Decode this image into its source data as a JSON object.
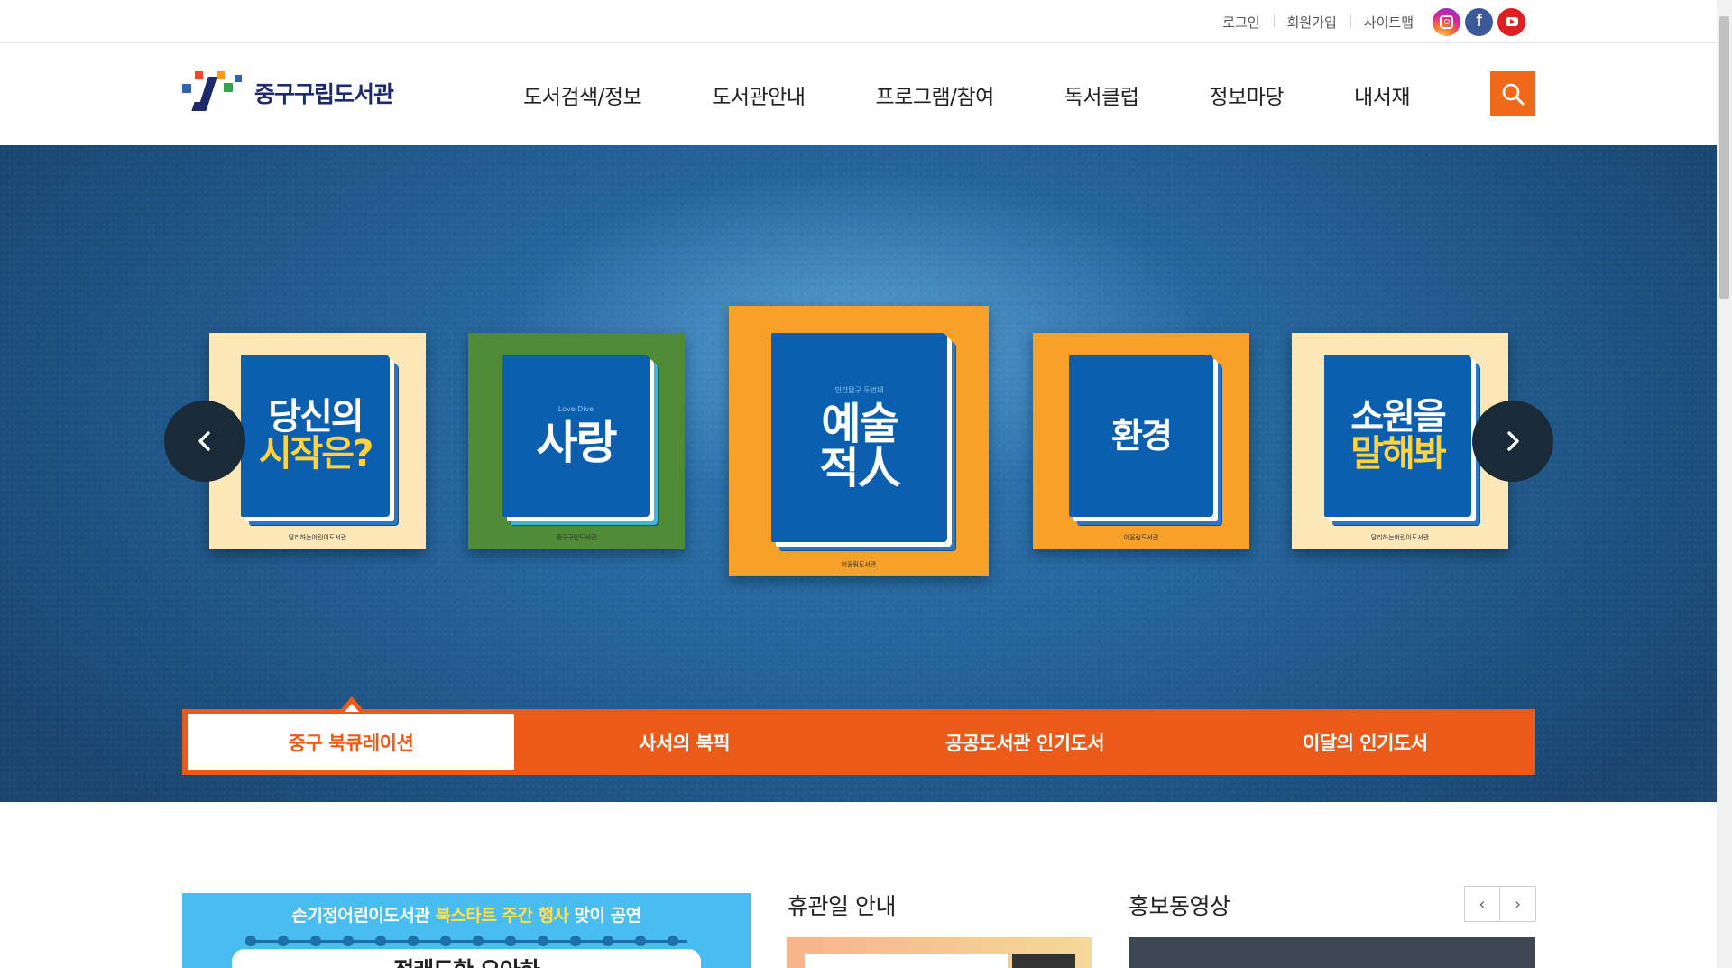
{
  "top_links": {
    "login": "로그인",
    "join": "회원가입",
    "sitemap": "사이트맵"
  },
  "sns": [
    "instagram-icon",
    "facebook-icon",
    "youtube-icon"
  ],
  "logo": {
    "text": "중구구립도서관"
  },
  "gnb": [
    "도서검색/정보",
    "도서관안내",
    "프로그램/참여",
    "독서클럽",
    "정보마당",
    "내서재"
  ],
  "slides": [
    {
      "title_line1": "당신의",
      "title_line2": "시작은?",
      "footer": "달리하는어린이도서관",
      "background": "#fbe7b8"
    },
    {
      "subtitle": "Love Dive",
      "title_line1": "사랑",
      "footer": "중구구립도서관",
      "background": "#4f8a34"
    },
    {
      "subtitle": "인간탐구 두번째",
      "title_line1": "예술",
      "title_line2": "적人",
      "footer": "어울림도서관",
      "background": "#f7a12a"
    },
    {
      "title_line1": "환경",
      "footer": "어울림도서관",
      "background": "#f7a12a"
    },
    {
      "title_line1": "소원을",
      "title_line2": "말해봐",
      "footer": "달리하는어린이도서관",
      "background": "#fbe7b8"
    }
  ],
  "tabs": [
    "중구 북큐레이션",
    "사서의 북픽",
    "공공도서관 인기도서",
    "이달의 인기도서"
  ],
  "banner": {
    "headline_pre": "손기정어린이도서관 ",
    "headline_highlight": "북스타트 주간 행사",
    "headline_post": " 맞이 공연",
    "card_title": "정래도한 오아하"
  },
  "closed_title": "휴관일 안내",
  "video_title": "홍보동영상",
  "colors": {
    "accent": "#ec5a1a",
    "search": "#f0691a",
    "navy": "#1c2a6b"
  }
}
